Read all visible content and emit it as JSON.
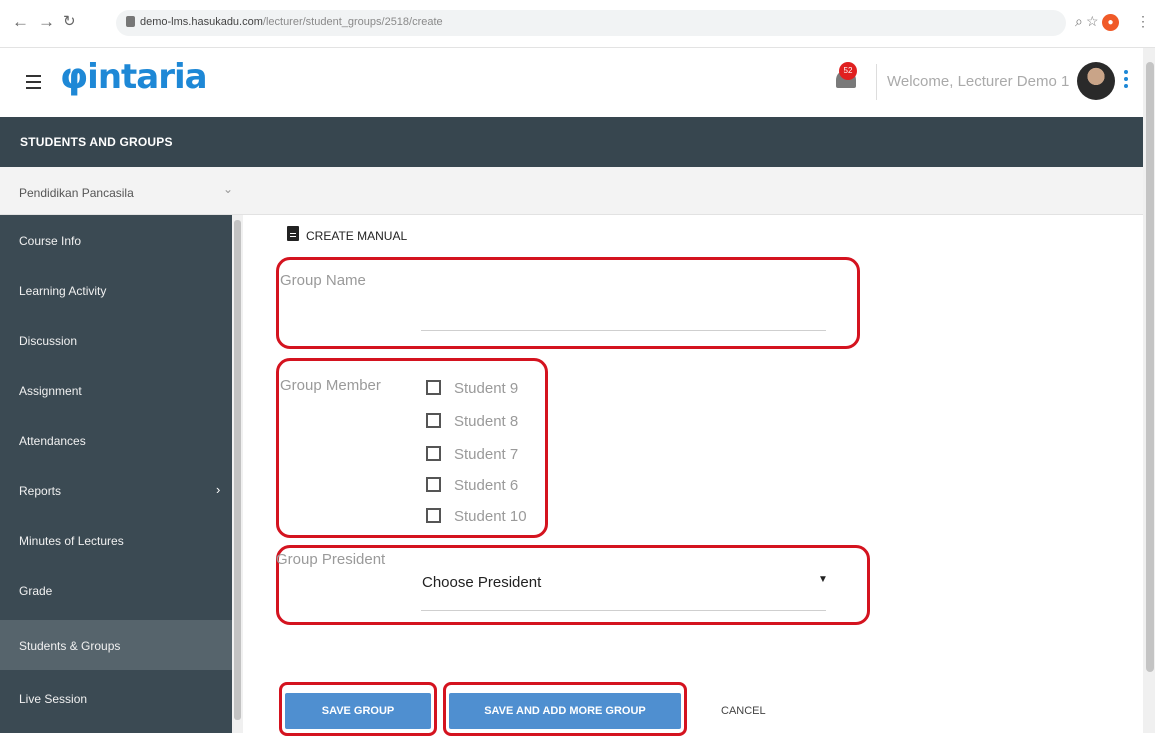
{
  "browser": {
    "url_host": "demo-lms.hasukadu.com",
    "url_path": "/lecturer/student_groups/2518/create"
  },
  "header": {
    "logo_text": "intaria",
    "notification_count": "52",
    "welcome_text": "Welcome, Lecturer Demo 1"
  },
  "section": {
    "title": "STUDENTS AND GROUPS"
  },
  "course": {
    "name": "Pendidikan Pancasila"
  },
  "sidebar": {
    "items": [
      {
        "label": "Course Info"
      },
      {
        "label": "Learning Activity"
      },
      {
        "label": "Discussion"
      },
      {
        "label": "Assignment"
      },
      {
        "label": "Attendances"
      },
      {
        "label": "Reports"
      },
      {
        "label": "Minutes of Lectures"
      },
      {
        "label": "Grade"
      },
      {
        "label": "Students & Groups"
      },
      {
        "label": "Live Session"
      }
    ]
  },
  "form": {
    "heading": "CREATE MANUAL",
    "group_name_label": "Group Name",
    "group_member_label": "Group Member",
    "members": [
      {
        "label": "Student 9",
        "checked": false
      },
      {
        "label": "Student 8",
        "checked": false
      },
      {
        "label": "Student 7",
        "checked": false
      },
      {
        "label": "Student 6",
        "checked": false
      },
      {
        "label": "Student 10",
        "checked": false
      }
    ],
    "president_label": "Group President",
    "president_selected": "Choose President",
    "buttons": {
      "save": "SAVE GROUP",
      "save_more": "SAVE AND ADD MORE GROUP",
      "cancel": "CANCEL"
    }
  },
  "colors": {
    "accent": "#1e88d6",
    "sidebar": "#3b4a53",
    "highlight_outline": "#d4131f",
    "button": "#4f8fd0"
  },
  "icons": {
    "menu": "hamburger-icon",
    "bell": "bell-icon",
    "document": "document-icon",
    "chevron": "chevron-down-icon",
    "more": "kebab-icon"
  }
}
